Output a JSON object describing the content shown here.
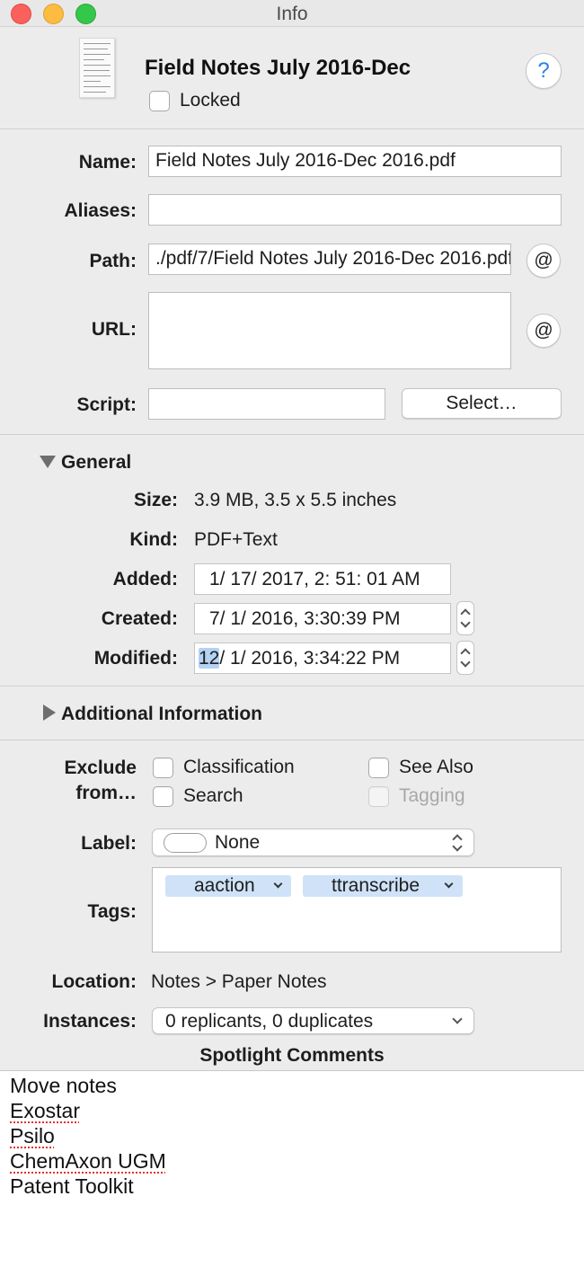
{
  "window": {
    "title": "Info"
  },
  "header": {
    "doc_title": "Field Notes July 2016-Dec",
    "locked_label": "Locked",
    "locked": false,
    "help_glyph": "?"
  },
  "fields": {
    "name_label": "Name:",
    "name_value": "Field Notes July 2016-Dec 2016.pdf",
    "aliases_label": "Aliases:",
    "aliases_value": "",
    "path_label": "Path:",
    "path_value": "./pdf/7/Field Notes July 2016-Dec 2016.pdf",
    "url_label": "URL:",
    "url_value": "",
    "script_label": "Script:",
    "script_value": "",
    "select_button": "Select…",
    "at_glyph": "@"
  },
  "general": {
    "title": "General",
    "expanded": true,
    "size_label": "Size:",
    "size_value": "3.9 MB, 3.5 x 5.5 inches",
    "kind_label": "Kind:",
    "kind_value": "PDF+Text",
    "added_label": "Added:",
    "added_value": "1/ 17/ 2017,   2: 51: 01 AM",
    "created_label": "Created:",
    "created_value": "7/   1/ 2016,   3:30:39 PM",
    "modified_label": "Modified:",
    "modified_selected": "12",
    "modified_rest": "/   1/ 2016,   3:34:22 PM"
  },
  "additional": {
    "title": "Additional Information",
    "expanded": false
  },
  "exclude": {
    "label_line1": "Exclude",
    "label_line2": "from…",
    "options": [
      {
        "label": "Classification",
        "checked": false,
        "enabled": true
      },
      {
        "label": "See Also",
        "checked": false,
        "enabled": true
      },
      {
        "label": "Search",
        "checked": false,
        "enabled": true
      },
      {
        "label": "Tagging",
        "checked": false,
        "enabled": false
      }
    ]
  },
  "label_popup": {
    "label": "Label:",
    "value": "None"
  },
  "tags": {
    "label": "Tags:",
    "items": [
      {
        "text": "aaction"
      },
      {
        "text": "ttranscribe"
      }
    ]
  },
  "location": {
    "label": "Location:",
    "value": "Notes > Paper Notes"
  },
  "instances": {
    "label": "Instances:",
    "value": "0 replicants, 0 duplicates"
  },
  "spotlight": {
    "title": "Spotlight Comments",
    "lines": [
      {
        "text": "Move notes",
        "misspelled": false
      },
      {
        "text": "Exostar",
        "misspelled": true
      },
      {
        "text": "Psilo",
        "misspelled": true
      },
      {
        "text": "ChemAxon UGM",
        "misspelled": true
      },
      {
        "text": "Patent Toolkit",
        "misspelled": false
      }
    ]
  },
  "colors": {
    "close": "#fc605c",
    "minimize": "#fdbc40",
    "maximize": "#34c84a",
    "help_accent": "#2a82ea",
    "tag_bg": "#cfe2f8",
    "selection": "#b3d2f4"
  }
}
